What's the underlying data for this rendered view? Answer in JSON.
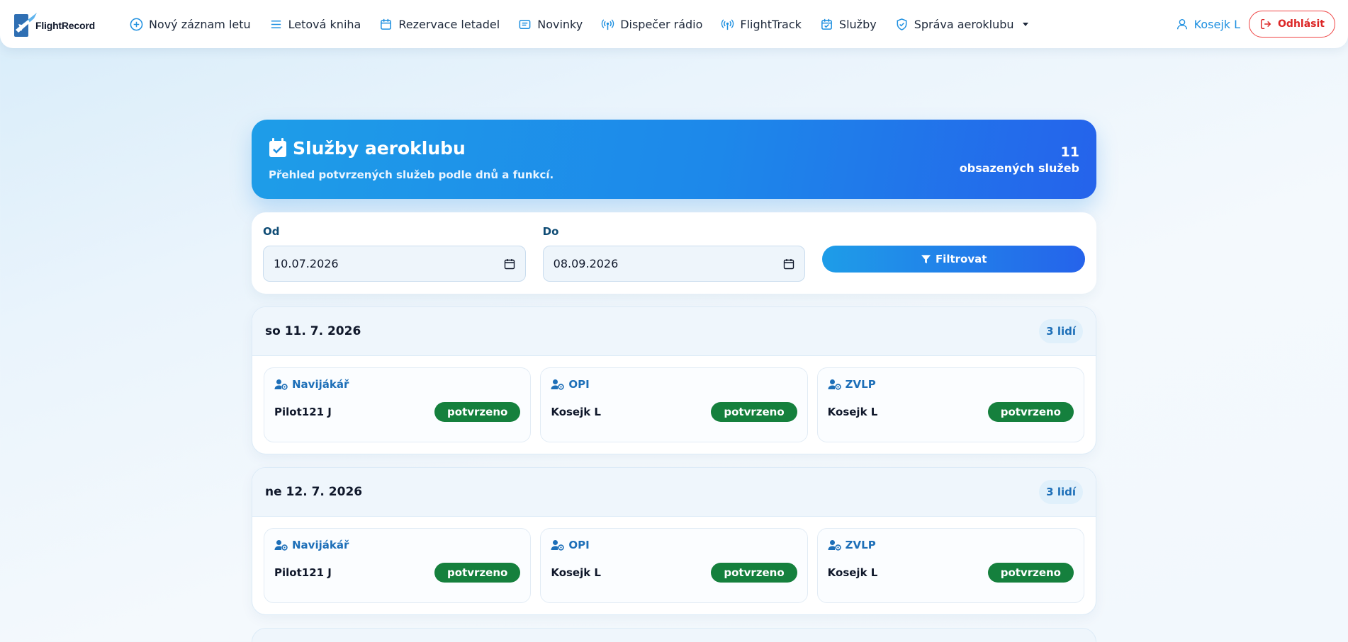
{
  "brand": {
    "name": "FlightRecord"
  },
  "nav": {
    "items": [
      {
        "label": "Nový záznam letu",
        "icon": "plus-circle-icon"
      },
      {
        "label": "Letová kniha",
        "icon": "list-icon"
      },
      {
        "label": "Rezervace letadel",
        "icon": "calendar-icon"
      },
      {
        "label": "Novinky",
        "icon": "news-icon"
      },
      {
        "label": "Dispečer rádio",
        "icon": "radio-icon"
      },
      {
        "label": "FlightTrack",
        "icon": "radio-icon"
      },
      {
        "label": "Služby",
        "icon": "calendar-check-icon"
      },
      {
        "label": "Správa aeroklubu",
        "icon": "shield-icon"
      }
    ],
    "user": "Kosejk L",
    "logout": "Odhlásit"
  },
  "hero": {
    "title": "Služby aeroklubu",
    "subtitle": "Přehled potvrzených služeb podle dnů a funkcí.",
    "count": "11",
    "count_label": "obsazených služeb"
  },
  "filter": {
    "from_label": "Od",
    "from_value": "10.07.2026",
    "to_label": "Do",
    "to_value": "08.09.2026",
    "button_label": "Filtrovat"
  },
  "days": [
    {
      "title": "so 11. 7. 2026",
      "people": "3 lidí",
      "duties": [
        {
          "role": "Navijákář",
          "person": "Pilot121 J",
          "status": "potvrzeno"
        },
        {
          "role": "OPI",
          "person": "Kosejk L",
          "status": "potvrzeno"
        },
        {
          "role": "ZVLP",
          "person": "Kosejk L",
          "status": "potvrzeno"
        }
      ]
    },
    {
      "title": "ne 12. 7. 2026",
      "people": "3 lidí",
      "duties": [
        {
          "role": "Navijákář",
          "person": "Pilot121 J",
          "status": "potvrzeno"
        },
        {
          "role": "OPI",
          "person": "Kosejk L",
          "status": "potvrzeno"
        },
        {
          "role": "ZVLP",
          "person": "Kosejk L",
          "status": "potvrzeno"
        }
      ]
    }
  ],
  "colors": {
    "accent": "#1d8fe0",
    "hero_start": "#1e9de8",
    "hero_end": "#2563eb",
    "confirmed": "#15803d",
    "logout": "#dc2626"
  }
}
